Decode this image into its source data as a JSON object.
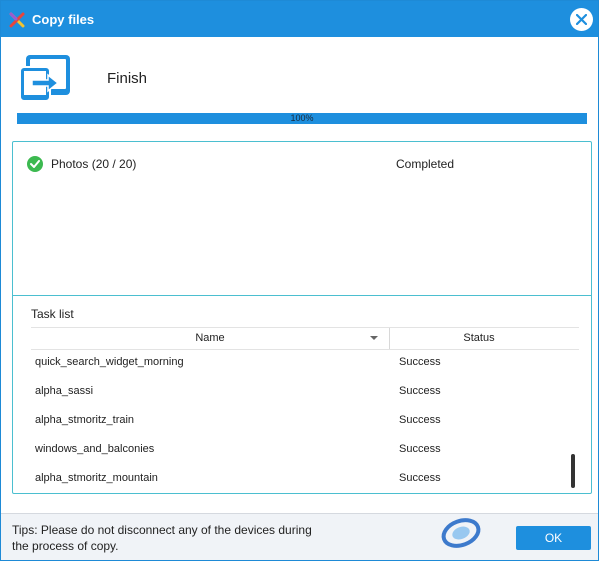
{
  "window": {
    "title": "Copy files",
    "accent": "#1e8fde"
  },
  "header": {
    "status": "Finish"
  },
  "progress": {
    "value": 100,
    "label": "100%"
  },
  "group": {
    "label": "Photos (20 / 20)",
    "status": "Completed"
  },
  "task_list": {
    "title": "Task list",
    "columns": {
      "name": "Name",
      "status": "Status"
    },
    "rows": [
      {
        "name": "quick_search_widget_morning",
        "status": "Success"
      },
      {
        "name": "alpha_sassi",
        "status": "Success"
      },
      {
        "name": "alpha_stmoritz_train",
        "status": "Success"
      },
      {
        "name": "windows_and_balconies",
        "status": "Success"
      },
      {
        "name": "alpha_stmoritz_mountain",
        "status": "Success"
      }
    ]
  },
  "footer": {
    "tips": "Tips: Please do not disconnect any of the devices during the process of copy.",
    "ok_label": "OK"
  },
  "icons": {
    "app": "copy-files-app-icon",
    "close": "close-icon",
    "transfer": "device-transfer-icon",
    "check": "check-circle-icon",
    "sort": "sort-arrow-icon"
  }
}
